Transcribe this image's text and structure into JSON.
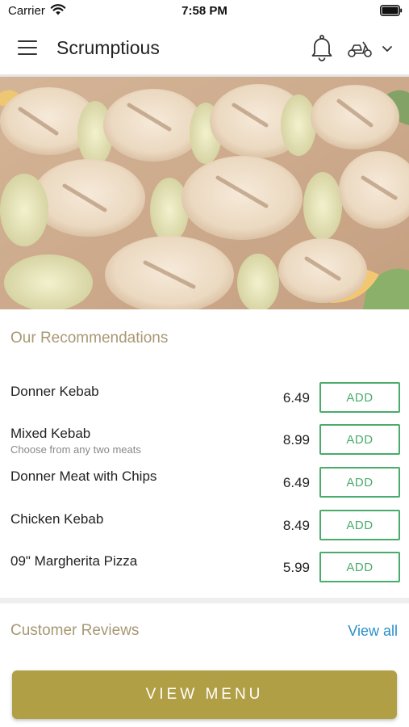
{
  "status_bar": {
    "carrier": "Carrier",
    "time": "7:58 PM",
    "icons": [
      "wifi-icon",
      "battery-icon"
    ]
  },
  "header": {
    "title": "Scrumptious",
    "icons": [
      "menu-icon",
      "bell-icon",
      "scooter-icon",
      "chevron-down-icon"
    ]
  },
  "hero": {
    "image": "grilled chicken kebab skewers with leeks and peppers"
  },
  "recommendations": {
    "title": "Our Recommendations",
    "items": [
      {
        "name": "Donner Kebab",
        "subtitle": "",
        "price": "6.49",
        "add_label": "ADD"
      },
      {
        "name": "Mixed Kebab",
        "subtitle": "Choose from any two meats",
        "price": "8.99",
        "add_label": "ADD"
      },
      {
        "name": "Donner Meat with Chips",
        "subtitle": "",
        "price": "6.49",
        "add_label": "ADD"
      },
      {
        "name": "Chicken Kebab",
        "subtitle": "",
        "price": "8.49",
        "add_label": "ADD"
      },
      {
        "name": "09\" Margherita Pizza",
        "subtitle": "",
        "price": "5.99",
        "add_label": "ADD"
      }
    ]
  },
  "reviews": {
    "title": "Customer Reviews",
    "view_all_label": "View all"
  },
  "footer": {
    "view_menu_label": "VIEW MENU"
  },
  "colors": {
    "accent_gold": "#b19f45",
    "section_title": "#a89874",
    "add_green": "#4aab6a",
    "link_blue": "#2b8fc9"
  }
}
